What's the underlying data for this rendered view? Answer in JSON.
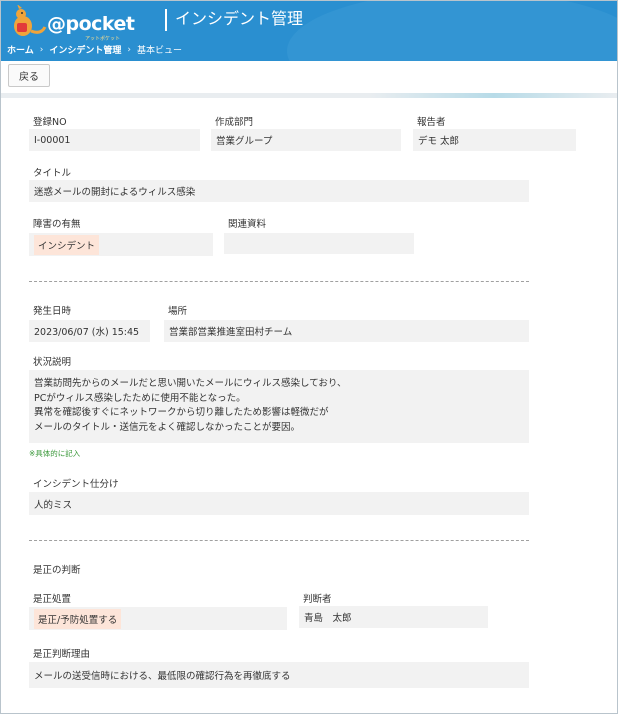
{
  "header": {
    "logo": "@pocket",
    "logo_sub": "アットポケット",
    "title": "インシデント管理",
    "breadcrumb": [
      "ホーム",
      "インシデント管理",
      "基本ビュー"
    ],
    "breadcrumb_sep": "›"
  },
  "toolbar": {
    "back_label": "戻る"
  },
  "colors": {
    "header": "#2a8fd0",
    "field_bg": "#f2f2f2",
    "tag_bg": "#fde5d9",
    "note": "#3d9a3d"
  },
  "section1": {
    "reg_no": {
      "label": "登録NO",
      "value": "I-00001"
    },
    "department": {
      "label": "作成部門",
      "value": "営業グループ"
    },
    "reporter": {
      "label": "報告者",
      "value": "デモ 太郎"
    },
    "title": {
      "label": "タイトル",
      "value": "迷惑メールの開封によるウィルス感染"
    },
    "failure": {
      "label": "障害の有無",
      "value": "インシデント"
    },
    "related": {
      "label": "関連資料",
      "value": ""
    }
  },
  "section2": {
    "datetime": {
      "label": "発生日時",
      "value": "2023/06/07 (水) 15:45"
    },
    "place": {
      "label": "場所",
      "value": "営業部営業推進室田村チーム"
    },
    "description": {
      "label": "状況説明",
      "lines": [
        "営業訪問先からのメールだと思い開いたメールにウィルス感染しており、",
        "PCがウィルス感染したために使用不能となった。",
        "異常を確認後すぐにネットワークから切り離したため影響は軽微だが",
        "メールのタイトル・送信元をよく確認しなかったことが要因。"
      ],
      "note": "※具体的に記入"
    },
    "classification": {
      "label": "インシデント仕分け",
      "value": "人的ミス"
    }
  },
  "section3": {
    "heading": "是正の判断",
    "action": {
      "label": "是正処置",
      "value": "是正/予防処置する"
    },
    "judge": {
      "label": "判断者",
      "value": "青島　太郎"
    },
    "reason": {
      "label": "是正判断理由",
      "value": "メールの送受信時における、最低限の確認行為を再徹底する"
    }
  }
}
